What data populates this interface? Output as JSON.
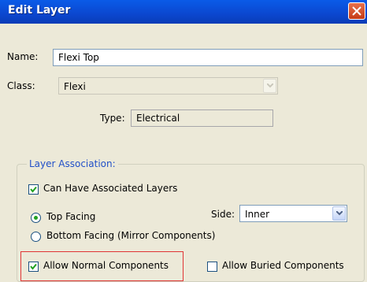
{
  "window": {
    "title": "Edit Layer"
  },
  "fields": {
    "name_label": "Name:",
    "name_value": "Flexi Top",
    "class_label": "Class:",
    "class_value": "Flexi",
    "type_label": "Type:",
    "type_value": "Electrical"
  },
  "layer_association": {
    "title": "Layer Association:",
    "can_have_associated": {
      "label": "Can Have Associated Layers",
      "checked": true
    },
    "top_facing": {
      "label": "Top Facing",
      "selected": true
    },
    "bottom_facing": {
      "label": "Bottom Facing (Mirror Components)",
      "selected": false
    },
    "side_label": "Side:",
    "side_value": "Inner",
    "allow_normal": {
      "label": "Allow Normal Components",
      "checked": true
    },
    "allow_buried": {
      "label": "Allow Buried Components",
      "checked": false
    }
  },
  "colors": {
    "titlebar": "#0a5be8",
    "group_title": "#2150c8",
    "highlight": "#e03535",
    "radio_dot": "#21a121"
  },
  "icons": {
    "close": "close-icon",
    "dropdown": "chevron-down-icon",
    "check": "check-icon"
  }
}
